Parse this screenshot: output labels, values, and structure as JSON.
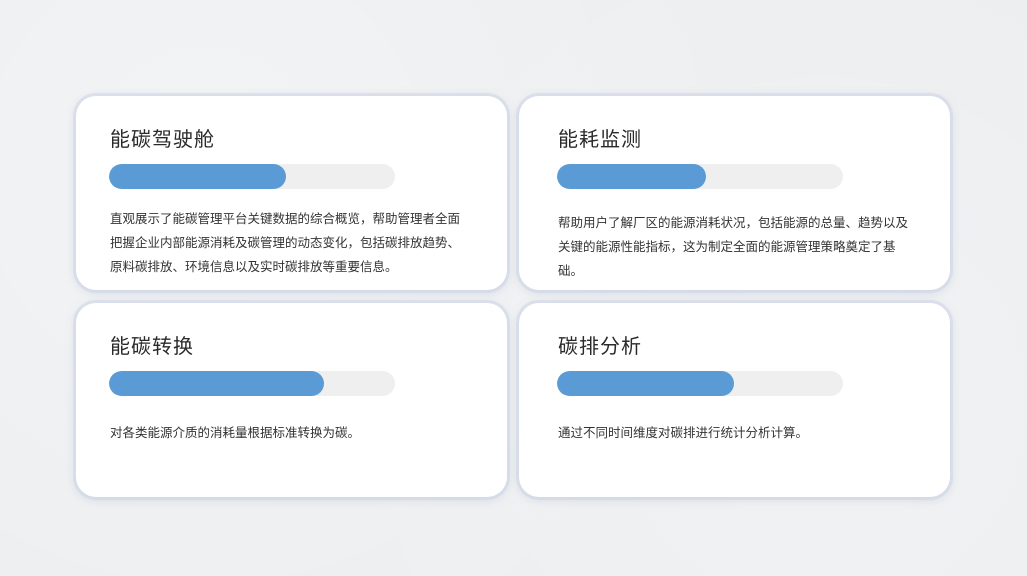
{
  "cards": [
    {
      "title": "能碳驾驶舱",
      "progress": 0.62,
      "description": "直观展示了能碳管理平台关键数据的综合概览，帮助管理者全面把握企业内部能源消耗及碳管理的动态变化，包括碳排放趋势、原料碳排放、环境信息以及实时碳排放等重要信息。"
    },
    {
      "title": "能耗监测",
      "progress": 0.52,
      "description": "帮助用户了解厂区的能源消耗状况，包括能源的总量、趋势以及关键的能源性能指标，这为制定全面的能源管理策略奠定了基础。"
    },
    {
      "title": "能碳转换",
      "progress": 0.75,
      "description": "对各类能源介质的消耗量根据标准转换为碳。"
    },
    {
      "title": "碳排分析",
      "progress": 0.62,
      "description": "通过不同时间维度对碳排进行统计分析计算。"
    }
  ],
  "colors": {
    "progress_fill": "#5b9bd5",
    "progress_track": "#efefef",
    "card_background": "#ffffff",
    "page_background": "#eceef0"
  }
}
